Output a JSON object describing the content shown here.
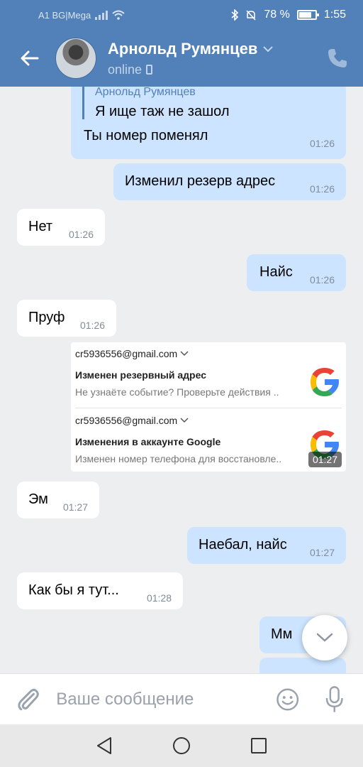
{
  "status_bar": {
    "carrier": "A1 BG|Mega",
    "battery": "78 %",
    "time": "1:55"
  },
  "header": {
    "contact_name": "Арнольд Румянцев",
    "status": "online"
  },
  "messages": [
    {
      "quote_author": "Арнольд Румянцев",
      "quote_text": "Я ище таж не зашол",
      "text": "Ты номер поменял",
      "time": "01:26"
    },
    {
      "text": "Изменил резерв адрес",
      "time": "01:26"
    },
    {
      "text": "Нет",
      "time": "01:26"
    },
    {
      "text": "Найс",
      "time": "01:26"
    },
    {
      "text": "Пруф",
      "time": "01:26"
    },
    {
      "text": "Эм",
      "time": "01:27"
    },
    {
      "text": "Наебал, найс",
      "time": "01:27"
    },
    {
      "text": "Как бы я тут...",
      "time": "01:28"
    },
    {
      "text": "Мм"
    }
  ],
  "attachment": {
    "time": "01:27",
    "cards": [
      {
        "email": "cr5936556@gmail.com",
        "subject": "Изменен резервный адрес",
        "preview": "Не узнаёте событие? Проверьте действия .."
      },
      {
        "email": "cr5936556@gmail.com",
        "subject": "Изменения в аккаунте Google",
        "preview": "Изменен номер телефона для восстановле.."
      }
    ]
  },
  "input": {
    "placeholder": "Ваше сообщение"
  },
  "colors": {
    "header": "#5181b8",
    "outgoing_bubble": "#cce4ff",
    "incoming_bubble": "#ffffff",
    "background": "#edeef0"
  }
}
